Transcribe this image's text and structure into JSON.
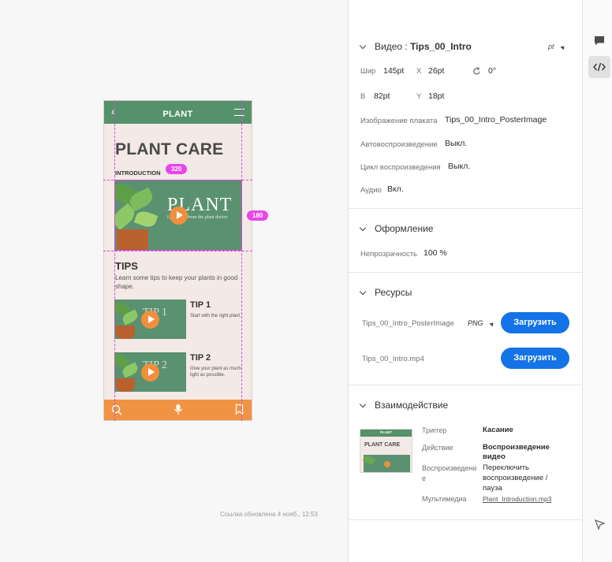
{
  "prototype": {
    "title": "PLANT",
    "heading": "PLANT CARE",
    "intro_label": "INTRODUCTION",
    "video_word": "PLANT",
    "video_sub": "Learn tips from the plant doctor",
    "tips_heading": "TIPS",
    "tips_desc": "Learn some tips to keep your plants in good shape.",
    "tips": [
      {
        "thumb_word": "TIP 1",
        "title": "TIP 1",
        "desc": "Start with the right plant."
      },
      {
        "thumb_word": "TIP 2",
        "title": "TIP 2",
        "desc": "Give your plant as much light as possible."
      }
    ]
  },
  "badges": {
    "width": "320",
    "height": "180"
  },
  "link_updated": "Ссылка обновлена 4 нояб., 12:53",
  "panel": {
    "video": {
      "title_prefix": "Видео : ",
      "title_name": "Tips_00_Intro",
      "unit": "pt",
      "width_label": "Шир",
      "width_value": "145pt",
      "x_label": "X",
      "x_value": "26pt",
      "rotation_value": "0°",
      "height_label": "В",
      "height_value": "82pt",
      "y_label": "Y",
      "y_value": "18pt",
      "poster_label": "Изображение плаката",
      "poster_value": "Tips_00_Intro_PosterImage",
      "autoplay_label": "Автовоспроизведение",
      "autoplay_value": "Выкл.",
      "loop_label": "Цикл воспроизведения",
      "loop_value": "Выкл.",
      "audio_label": "Аудио",
      "audio_value": "Вкл."
    },
    "appearance": {
      "title": "Оформление",
      "opacity_label": "Непрозрачность",
      "opacity_value": "100 %"
    },
    "resources": {
      "title": "Ресурсы",
      "items": [
        {
          "name": "Tips_00_Intro_PosterImage",
          "format": "PNG",
          "button": "Загрузить"
        },
        {
          "name": "Tips_00_Intro.mp4",
          "format": "",
          "button": "Загрузить"
        }
      ]
    },
    "interaction": {
      "title": "Взаимодействие",
      "trigger_label": "Триггер",
      "trigger_value": "Касание",
      "action_label": "Действие",
      "action_value": "Воспроизведение видео",
      "playback_label": "Воспроизведение",
      "playback_value": "Переключить воспроизведение / пауза",
      "media_label": "Мультимедиа",
      "media_value": "Plant_Introduction.mp3",
      "thumb_title": "PLANT",
      "thumb_heading": "PLANT CARE"
    }
  },
  "colors": {
    "accent": "#1473e6",
    "plant_green": "#55916a",
    "orange": "#f09443",
    "guide": "#d24bd9"
  }
}
